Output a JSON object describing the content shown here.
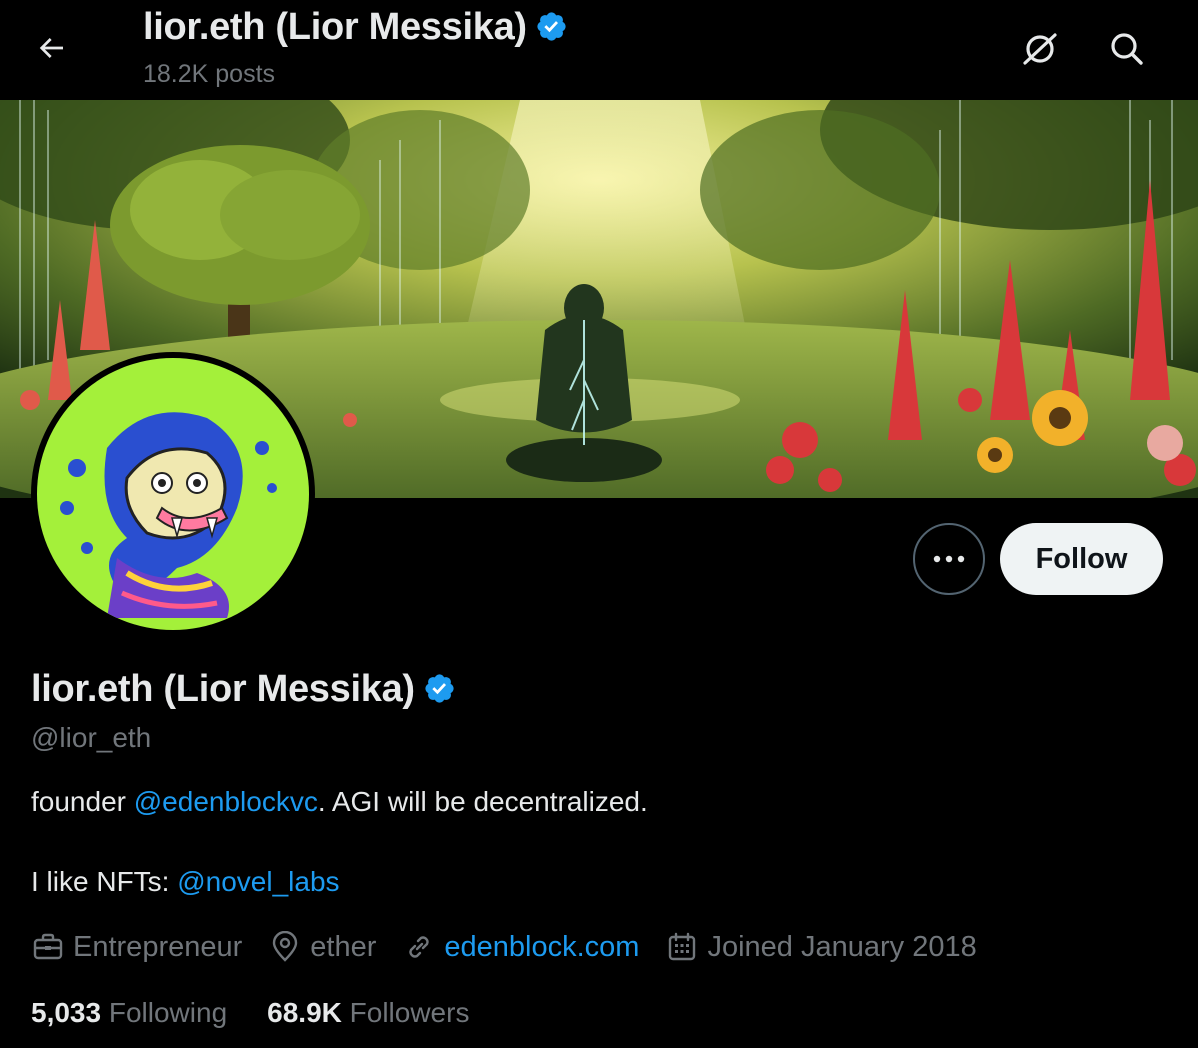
{
  "header": {
    "title": "lior.eth (Lior Messika)",
    "posts": "18.2K posts"
  },
  "profile": {
    "name": "lior.eth (Lior Messika)",
    "handle": "@lior_eth",
    "follow_label": "Follow",
    "bio": {
      "line1_prefix": "founder ",
      "line1_mention": "@edenblockvc",
      "line1_suffix": ". AGI will be decentralized.",
      "line2_prefix": "I like NFTs: ",
      "line2_mention": "@novel_labs"
    },
    "meta": {
      "profession": "Entrepreneur",
      "location": "ether",
      "website": "edenblock.com",
      "joined": "Joined January 2018"
    },
    "stats": {
      "following_count": "5,033",
      "following_label": "Following",
      "followers_count": "68.9K",
      "followers_label": "Followers"
    }
  },
  "colors": {
    "background": "#000000",
    "accent": "#1d9bf0",
    "text_primary": "#e7e9ea",
    "text_secondary": "#71767b",
    "follow_button_bg": "#eff3f4"
  },
  "icons": {
    "back": "arrow-left-icon",
    "grok": "grok-icon",
    "search": "search-icon",
    "verified": "verified-badge-icon",
    "more": "more-horizontal-icon",
    "profession": "briefcase-icon",
    "location": "location-pin-icon",
    "website": "link-icon",
    "joined": "calendar-icon"
  }
}
